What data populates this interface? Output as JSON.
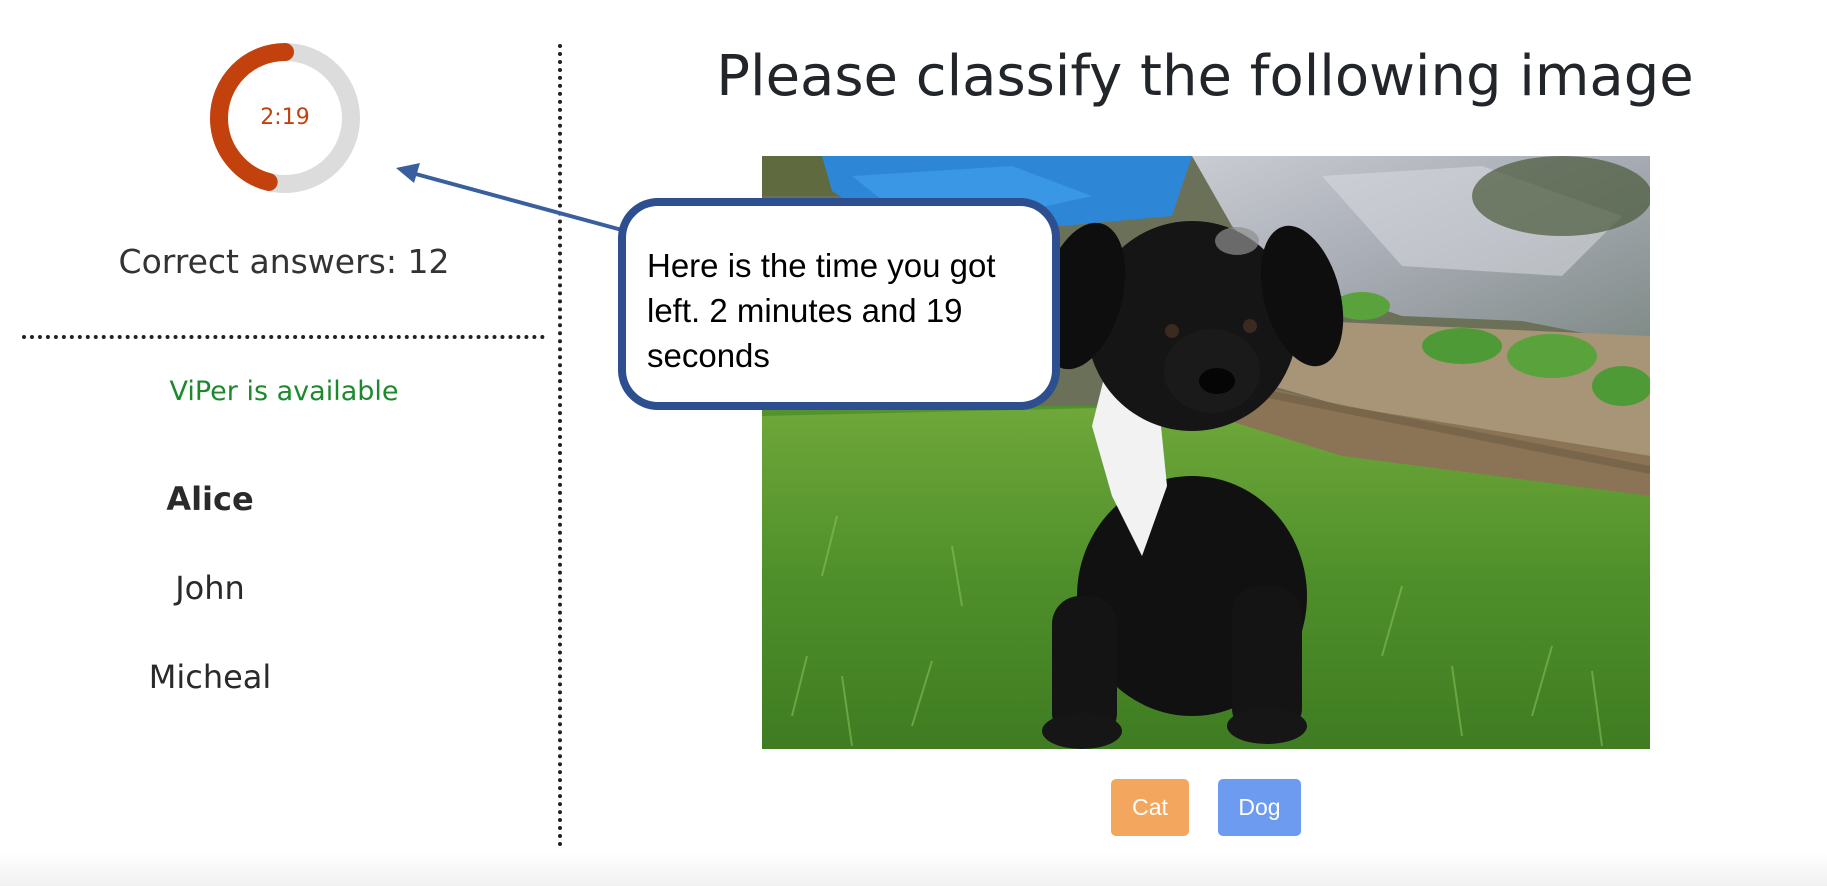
{
  "timer": {
    "label": "2:19",
    "remaining_fraction": 0.46,
    "colors": {
      "progress": "#c2410c",
      "track": "#dcdcdc"
    }
  },
  "stats": {
    "correct_answers": "Correct answers: 12"
  },
  "status": {
    "text": "ViPer is available",
    "color": "#1c8a2c"
  },
  "users": {
    "items": [
      {
        "name": "Alice",
        "active": true
      },
      {
        "name": "John",
        "active": false
      },
      {
        "name": "Micheal",
        "active": false
      }
    ]
  },
  "main": {
    "title": "Please classify the following image",
    "image": {
      "subject": "black-puppy-on-grass"
    },
    "buttons": [
      {
        "label": "Cat",
        "color": "#f2a65e"
      },
      {
        "label": "Dog",
        "color": "#6d9bf0"
      }
    ]
  },
  "callout": {
    "lines": [
      "Here is the time you got",
      "left. 2 minutes and 19",
      "seconds"
    ],
    "border_color": "#2d4e8f"
  }
}
